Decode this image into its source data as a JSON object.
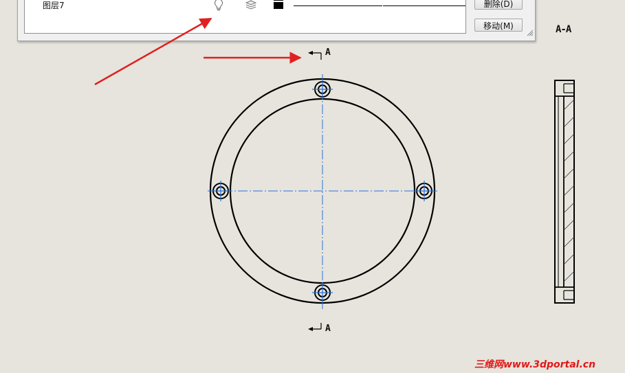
{
  "layer_dialog": {
    "rows": [
      {
        "name": ""
      },
      {
        "name": "图层7"
      }
    ],
    "delete_button": "删除(D)",
    "move_button": "移动(M)"
  },
  "drawing": {
    "section_view_label": "A-A",
    "section_marker_top": "A",
    "section_marker_bottom": "A",
    "centerline_color": "#2a6fdb",
    "annotation_arrow_color": "#e02020"
  },
  "watermark": "三维网www.3dportal.cn"
}
